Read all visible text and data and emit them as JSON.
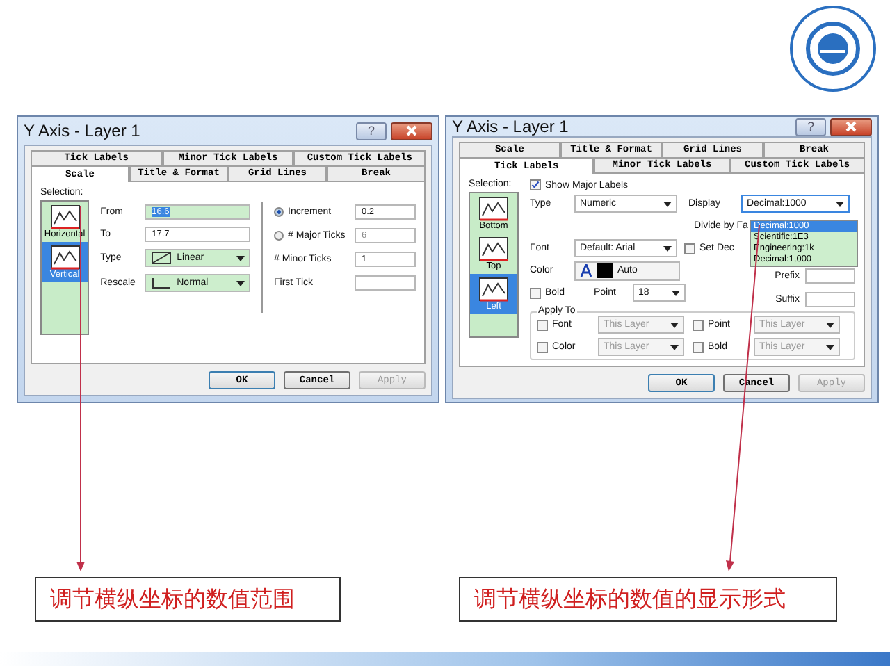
{
  "scale_dialog": {
    "title": "Y Axis - Layer 1",
    "help": "?",
    "tab_rows": [
      [
        {
          "label": "Tick Labels",
          "selected": false
        },
        {
          "label": "Minor Tick Labels",
          "selected": false
        },
        {
          "label": "Custom Tick Labels",
          "selected": false
        }
      ],
      [
        {
          "label": "Scale",
          "selected": true
        },
        {
          "label": "Title & Format",
          "selected": false
        },
        {
          "label": "Grid Lines",
          "selected": false
        },
        {
          "label": "Break",
          "selected": false
        }
      ]
    ],
    "selection": {
      "label": "Selection:",
      "items": [
        {
          "label": "Horizontal",
          "selected": false
        },
        {
          "label": "Vertical",
          "selected": true
        }
      ]
    },
    "from": {
      "label": "From",
      "value": "16.6"
    },
    "to": {
      "label": "To",
      "value": "17.7"
    },
    "type": {
      "label": "Type",
      "value": "Linear"
    },
    "rescale": {
      "label": "Rescale",
      "value": "Normal"
    },
    "increment": {
      "label": "Increment",
      "selected": true,
      "value": "0.2"
    },
    "major_ticks": {
      "label": "# Major Ticks",
      "selected": false,
      "value": "6"
    },
    "minor_ticks": {
      "label": "# Minor Ticks",
      "value": "1"
    },
    "first_tick": {
      "label": "First Tick"
    },
    "buttons": [
      {
        "label": "OK",
        "disabled": false
      },
      {
        "label": "Cancel",
        "disabled": false
      },
      {
        "label": "Apply",
        "disabled": true
      }
    ]
  },
  "tick_labels_dialog": {
    "title": "Y Axis - Layer 1",
    "help": "?",
    "tab_rows": [
      [
        {
          "label": "Scale",
          "selected": false
        },
        {
          "label": "Title & Format",
          "selected": false
        },
        {
          "label": "Grid Lines",
          "selected": false
        },
        {
          "label": "Break",
          "selected": false
        }
      ],
      [
        {
          "label": "Tick Labels",
          "selected": true
        },
        {
          "label": "Minor Tick Labels",
          "selected": false
        },
        {
          "label": "Custom Tick Labels",
          "selected": false
        }
      ]
    ],
    "selection": {
      "label": "Selection:",
      "items": [
        {
          "label": "Bottom",
          "selected": false
        },
        {
          "label": "Top",
          "selected": false
        },
        {
          "label": "Left",
          "selected": true
        }
      ]
    },
    "show_major_labels": {
      "label": "Show Major Labels",
      "checked": true
    },
    "type": {
      "label": "Type",
      "value": "Numeric"
    },
    "display": {
      "label": "Display",
      "value": "Decimal:1000",
      "options": [
        {
          "label": "Decimal:1000",
          "selected": true
        },
        {
          "label": "Scientific:1E3",
          "selected": false
        },
        {
          "label": "Engineering:1k",
          "selected": false
        },
        {
          "label": "Decimal:1,000",
          "selected": false
        }
      ]
    },
    "divide_by_factor": "Divide by Fa",
    "font": {
      "label": "Font",
      "value": "Default: Arial"
    },
    "set_decimal": {
      "label": "Set Dec",
      "checked": false
    },
    "color": {
      "label": "Color",
      "value": "Auto"
    },
    "prefix": {
      "label": "Prefix"
    },
    "suffix": {
      "label": "Suffix"
    },
    "bold": {
      "label": "Bold",
      "checked": false
    },
    "point": {
      "label": "Point",
      "value": "18"
    },
    "apply_to": {
      "label": "Apply To",
      "items": [
        {
          "label": "Font",
          "checked": false,
          "value": "This Layer"
        },
        {
          "label": "Point",
          "checked": false,
          "value": "This Layer"
        },
        {
          "label": "Color",
          "checked": false,
          "value": "This Layer"
        },
        {
          "label": "Bold",
          "checked": false,
          "value": "This Layer"
        }
      ]
    },
    "buttons": [
      {
        "label": "OK",
        "disabled": false
      },
      {
        "label": "Cancel",
        "disabled": false
      },
      {
        "label": "Apply",
        "disabled": true
      }
    ]
  },
  "captions": [
    "调节横纵坐标的数值范围",
    "调节横纵坐标的数值的显示形式"
  ]
}
